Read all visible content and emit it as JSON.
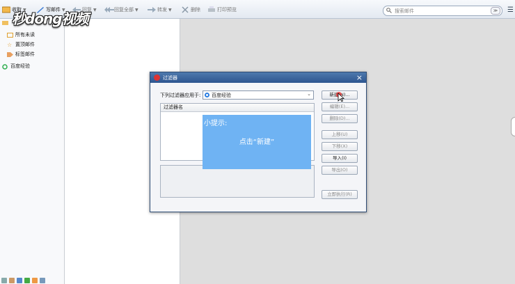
{
  "toolbar": {
    "receive": "收取",
    "compose": "写邮件",
    "reply": "回复",
    "reply_all": "回复全部",
    "forward": "转发",
    "delete": "删除",
    "print_preview": "打印预览",
    "search_placeholder": "搜索邮件",
    "search_btn": "≫"
  },
  "watermark": "秒dong视频",
  "sidebar": {
    "top_folder": "",
    "items": [
      {
        "label": "所有未读"
      },
      {
        "label": "置顶邮件"
      },
      {
        "label": "标签邮件"
      }
    ],
    "account": "百度经验"
  },
  "dialog": {
    "title": "过滤器",
    "apply_label": "下列过滤器应用于:",
    "apply_value": "百度经验",
    "col_name": "过滤器名",
    "buttons": {
      "new": "新建(N)...",
      "edit": "编辑(E)...",
      "delete": "删除(D)...",
      "up": "上移(U)",
      "down": "下移(X)",
      "import": "导入(I)",
      "export": "导出(O)",
      "run": "立即执行(R)"
    }
  },
  "tip": {
    "heading": "小提示:",
    "body": "点击“新建”"
  },
  "colors": {
    "tip_bg": "#6fb3f3",
    "title_bar": "#2d5590"
  }
}
